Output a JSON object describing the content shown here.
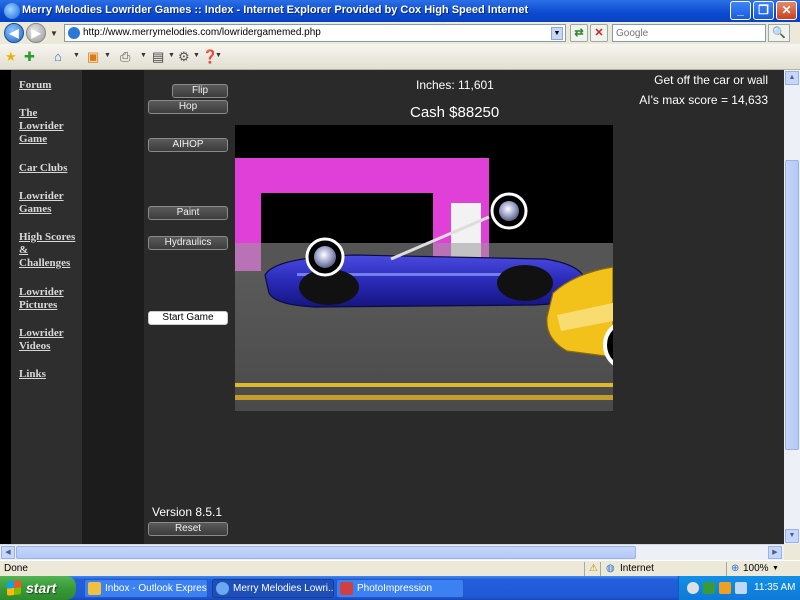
{
  "window": {
    "title": "Merry Melodies Lowrider Games :: Index - Internet Explorer Provided by Cox High Speed Internet",
    "minimize": "_",
    "maximize": "❐",
    "close": "✕"
  },
  "address_bar": {
    "url": "http://www.merrymelodies.com/lowridergamemed.php",
    "search_placeholder": "Google"
  },
  "sidebar": {
    "links": [
      "Forum",
      "The Lowrider Game",
      "Car Clubs",
      "Lowrider Games",
      "High Scores & Challenges",
      "Lowrider Pictures",
      "Lowrider Videos",
      "Links"
    ]
  },
  "game": {
    "buttons": {
      "flip": "Flip",
      "hop": "Hop",
      "aihop": "AIHOP",
      "paint": "Paint",
      "hydraulics": "Hydraulics",
      "start": "Start Game",
      "reset": "Reset"
    },
    "inches": "Inches: 11,601",
    "cash": "Cash $88250",
    "message": "Get off the car or wall",
    "ai_score": "AI's max score = 14,633",
    "version": "Version 8.5.1"
  },
  "status": {
    "text": "Done",
    "zone": "Internet",
    "zoom": "100%"
  },
  "taskbar": {
    "start": "start",
    "items": [
      "Inbox - Outlook Express",
      "Merry Melodies Lowri...",
      "PhotoImpression"
    ],
    "clock": "11:35 AM"
  },
  "colors": {
    "sidebar_bg": "#2e2e2e",
    "game_bg": "#2a2a2a",
    "wall_pink": "#e040d8",
    "car_blue": "#2a2ab8",
    "car_yellow": "#f2c21a",
    "taskbar_blue": "#245edb"
  }
}
